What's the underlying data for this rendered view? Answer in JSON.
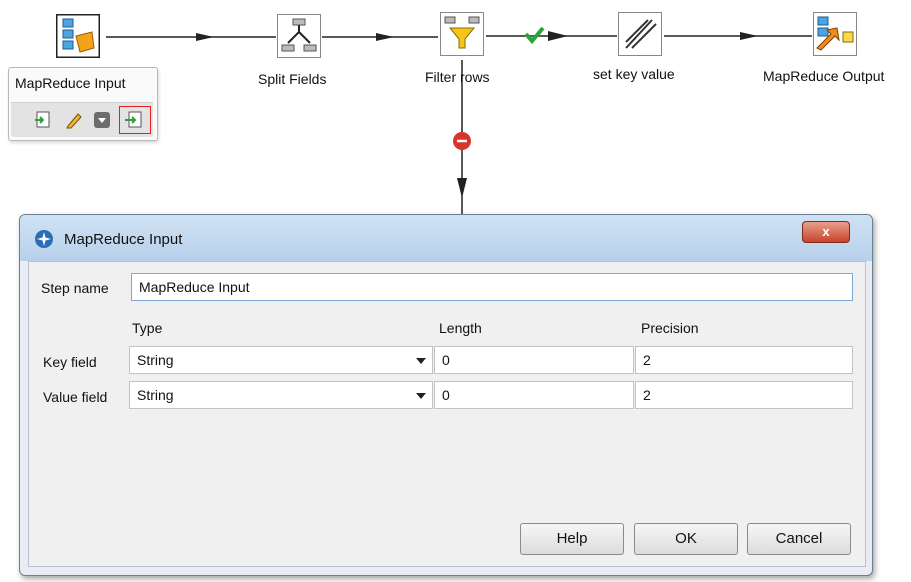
{
  "canvas": {
    "steps": [
      {
        "label": "MapReduce Input",
        "icon": "mapreduce-input-icon"
      },
      {
        "label": "Split Fields",
        "icon": "split-fields-icon"
      },
      {
        "label": "Filter rows",
        "icon": "filter-rows-icon"
      },
      {
        "label": "set key value",
        "icon": "set-key-value-icon"
      },
      {
        "label": "MapReduce Output",
        "icon": "mapreduce-output-icon"
      }
    ],
    "popup": {
      "title": "MapReduce Input",
      "actions": [
        "input-connector-icon",
        "edit-pencil-icon",
        "dropdown-menu-icon",
        "output-connector-icon"
      ]
    }
  },
  "dialog": {
    "title": "MapReduce Input",
    "close_label": "x",
    "step_name_label": "Step name",
    "step_name_value": "MapReduce Input",
    "columns": {
      "type": "Type",
      "length": "Length",
      "precision": "Precision"
    },
    "rows": [
      {
        "label": "Key field",
        "type": "String",
        "length": "0",
        "precision": "2"
      },
      {
        "label": "Value field",
        "type": "String",
        "length": "0",
        "precision": "2"
      }
    ],
    "buttons": {
      "help": "Help",
      "ok": "OK",
      "cancel": "Cancel"
    }
  },
  "colors": {
    "hop": "#222222",
    "true_check": "#2aa33b",
    "error_hop": "#d9342b",
    "highlight": "#e02020"
  }
}
